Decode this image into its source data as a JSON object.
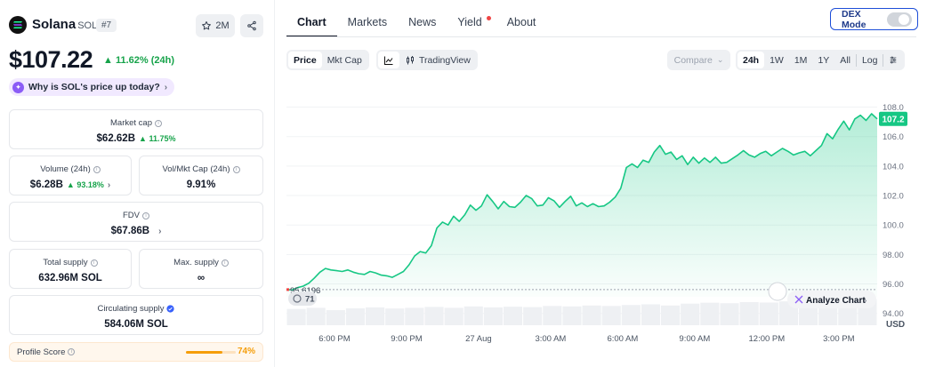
{
  "coin": {
    "name": "Solana",
    "symbol": "SOL",
    "rank": "#7",
    "watchlist_count": "2M",
    "price": "$107.22",
    "change_24h": "11.62% (24h)",
    "ask_prompt": "Why is SOL's price up today?"
  },
  "stats": {
    "market_cap": {
      "label": "Market cap",
      "value": "$62.62B",
      "change": "11.75%"
    },
    "volume": {
      "label": "Volume (24h)",
      "value": "$6.28B",
      "change": "93.18%"
    },
    "vol_mkt_cap": {
      "label": "Vol/Mkt Cap (24h)",
      "value": "9.91%"
    },
    "fdv": {
      "label": "FDV",
      "value": "$67.86B"
    },
    "total_supply": {
      "label": "Total supply",
      "value": "632.96M SOL"
    },
    "max_supply": {
      "label": "Max. supply",
      "value": "∞"
    },
    "circulating_supply": {
      "label": "Circulating supply",
      "value": "584.06M SOL"
    },
    "profile_score": {
      "label": "Profile Score",
      "value": "74%",
      "fraction": 0.74
    }
  },
  "tabs": [
    {
      "label": "Chart",
      "active": true
    },
    {
      "label": "Markets",
      "active": false
    },
    {
      "label": "News",
      "active": false
    },
    {
      "label": "Yield",
      "active": false,
      "dot": true
    },
    {
      "label": "About",
      "active": false
    }
  ],
  "dex_mode": {
    "label": "DEX Mode",
    "on": false
  },
  "toolbar": {
    "price_label": "Price",
    "mktcap_label": "Mkt Cap",
    "tradingview_label": "TradingView",
    "compare_label": "Compare",
    "ranges": [
      "24h",
      "1W",
      "1M",
      "1Y",
      "All"
    ],
    "active_range": "24h",
    "log_label": "Log"
  },
  "colors": {
    "accent_green": "#16c784",
    "positive_text": "#16a34a",
    "price_tag_bg": "#16c784",
    "profile_orange": "#f59e0b"
  },
  "chart_data": {
    "type": "area",
    "currency_label": "USD",
    "current_price_tag": "107.2",
    "open_price_label": "95.6196",
    "volume_badge": "71",
    "analyze_label": "Analyze Chart",
    "x_ticks": [
      "6:00 PM",
      "9:00 PM",
      "27 Aug",
      "3:00 AM",
      "6:00 AM",
      "9:00 AM",
      "12:00 PM",
      "3:00 PM"
    ],
    "x_tick_hours": [
      2,
      5,
      8,
      11,
      14,
      17,
      20,
      23
    ],
    "y_ticks": [
      "94.00",
      "96.00",
      "98.00",
      "100.0",
      "102.0",
      "104.0",
      "106.0",
      "108.0"
    ],
    "y_tick_values": [
      94,
      96,
      98,
      100,
      102,
      104,
      106,
      108
    ],
    "ylim": [
      93.2,
      109.6
    ],
    "xlim": [
      0,
      24.6
    ],
    "open_price": 95.6196,
    "series": [
      {
        "hours": [
          0,
          0.3,
          0.6,
          0.9,
          1.2,
          1.5,
          1.8,
          2.1,
          2.4,
          2.7,
          3.0,
          3.3,
          3.6,
          3.9,
          4.2,
          4.5,
          4.8,
          5.1,
          5.4,
          5.7,
          6.0,
          6.3,
          6.6,
          6.9,
          7.2,
          7.5,
          7.8,
          8.1,
          8.4,
          8.7,
          9.0,
          9.3,
          9.6,
          9.9,
          10.2,
          10.5,
          10.8,
          11.1,
          11.4,
          11.7,
          12.0,
          12.3,
          12.6,
          12.9,
          13.2,
          13.5,
          13.8,
          14.1,
          14.4,
          14.7,
          15.0,
          15.3,
          15.6,
          15.9,
          16.2,
          16.5,
          16.8,
          17.1,
          17.4,
          17.7,
          18.0,
          18.3,
          18.6,
          18.9,
          19.2,
          19.5,
          19.8,
          20.1,
          20.4,
          20.7,
          21.0,
          21.3,
          21.6,
          21.9,
          22.2,
          22.5,
          22.8,
          23.1,
          23.4,
          23.7,
          24.0,
          24.3,
          24.6
        ],
        "values": [
          95.62,
          95.6,
          95.75,
          95.85,
          96.05,
          96.4,
          96.8,
          97.05,
          96.95,
          96.9,
          96.85,
          96.95,
          96.8,
          96.7,
          96.65,
          96.85,
          96.75,
          96.6,
          96.55,
          96.45,
          96.65,
          96.85,
          97.3,
          97.9,
          98.2,
          98.1,
          98.6,
          99.8,
          100.2,
          100.0,
          100.6,
          100.25,
          100.7,
          101.35,
          101.0,
          101.3,
          102.05,
          101.6,
          101.1,
          101.6,
          101.25,
          101.2,
          101.55,
          102.0,
          101.8,
          101.3,
          101.35,
          101.85,
          101.65,
          101.2,
          101.6,
          101.95,
          101.3,
          101.5,
          101.25,
          101.45,
          101.25,
          101.3,
          101.55,
          101.9,
          102.5,
          103.9,
          104.15,
          103.9,
          104.4,
          104.25,
          104.95,
          105.4,
          104.8,
          104.95,
          104.45,
          104.7,
          104.1,
          104.6,
          104.2,
          104.55,
          104.25,
          104.6,
          104.2,
          104.25,
          104.5,
          104.75,
          105.05,
          104.75,
          104.6,
          104.85,
          105.0,
          104.7,
          104.95,
          105.2,
          105.0,
          104.75,
          104.9,
          105.0,
          104.7,
          105.05,
          105.4,
          106.2,
          105.85,
          106.5,
          107.05,
          106.45,
          107.2,
          107.45,
          107.1,
          107.55,
          107.2
        ]
      }
    ],
    "volume_bars_relative": [
      0.55,
      0.6,
      0.5,
      0.58,
      0.62,
      0.57,
      0.6,
      0.64,
      0.6,
      0.66,
      0.62,
      0.65,
      0.63,
      0.68,
      0.66,
      0.7,
      0.68,
      0.72,
      0.75,
      0.7,
      0.78,
      0.82,
      0.8,
      0.85,
      0.83,
      0.88,
      0.9,
      0.92,
      0.95,
      0.97
    ]
  }
}
